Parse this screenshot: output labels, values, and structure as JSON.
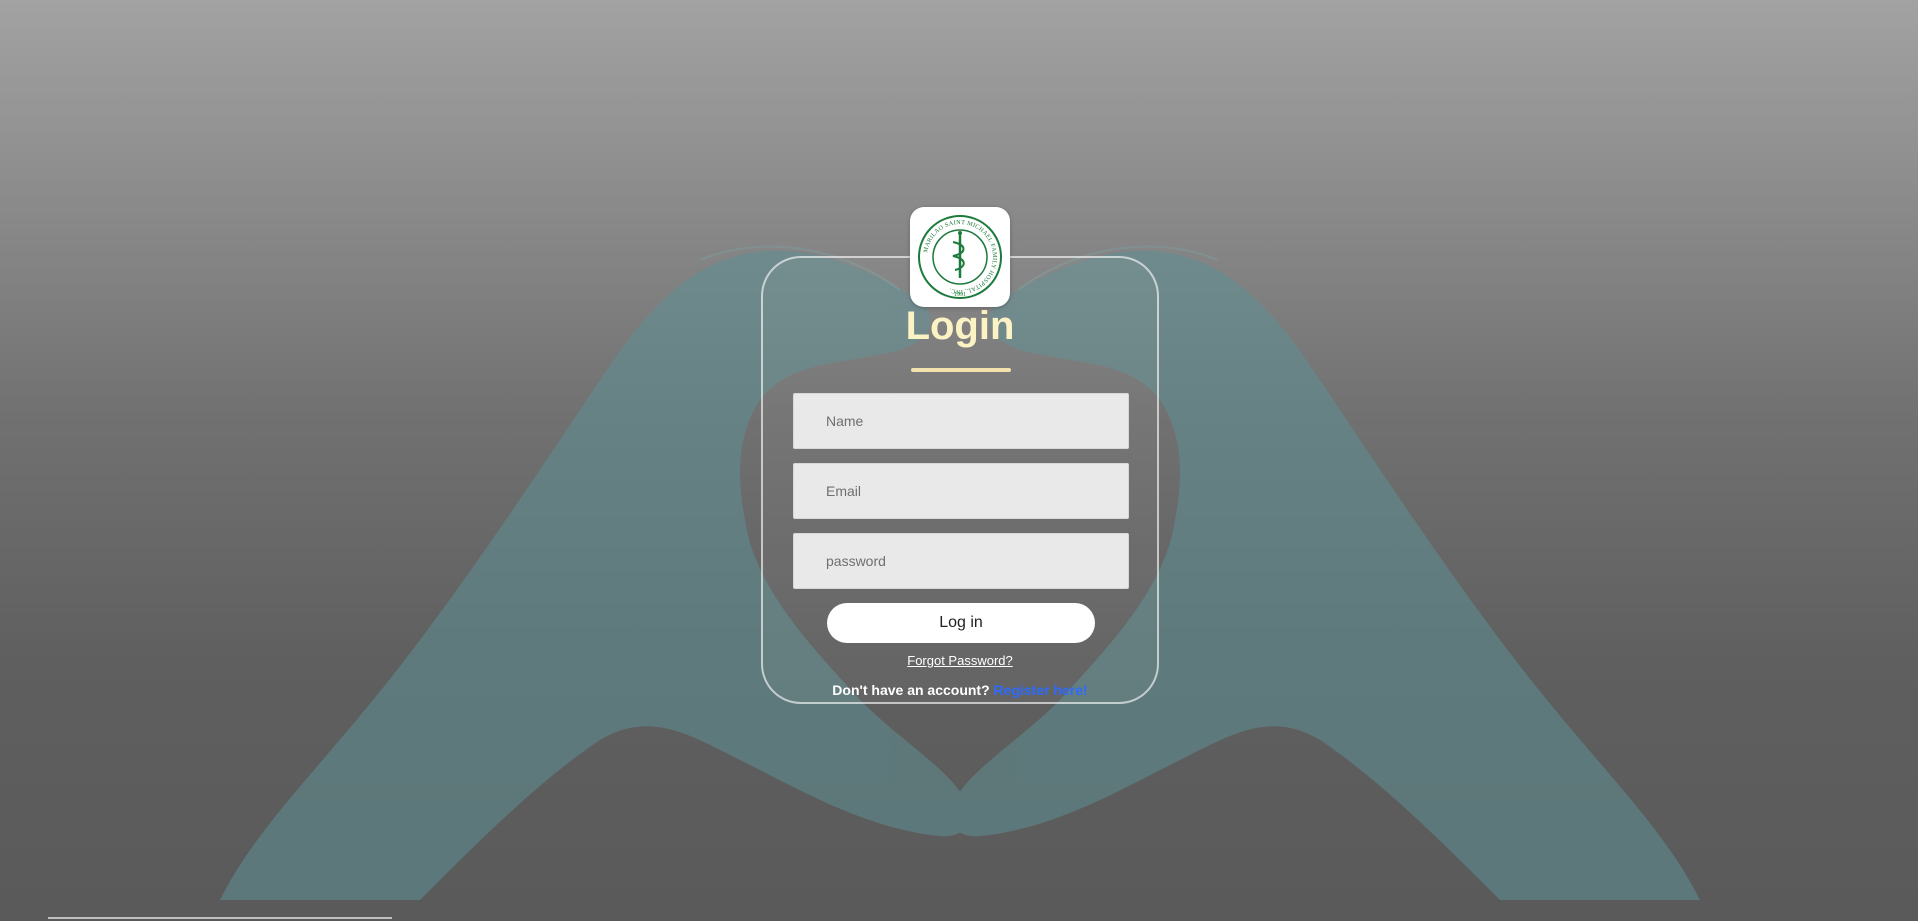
{
  "background": {
    "gradient_top": "#a2a2a2",
    "gradient_bottom": "#5a5a5a",
    "glove_color": "#5f8f93",
    "art": "heart-hands-gloves"
  },
  "logo": {
    "icon": "hospital-seal-icon",
    "seal_text": "MARILAO SAINT MICHAEL FAMILY HOSPITAL, INC.",
    "year": "1991",
    "seal_color": "#1c7a3c"
  },
  "login": {
    "title": "Login",
    "title_color": "#fbf3c4",
    "name_placeholder": "Name",
    "email_placeholder": "Email",
    "password_placeholder": "password",
    "login_button": "Log in",
    "forgot_password": "Forgot Password?",
    "no_account": "Don't have an account?",
    "register_link": "Register here!",
    "register_color": "#2d6bff"
  }
}
